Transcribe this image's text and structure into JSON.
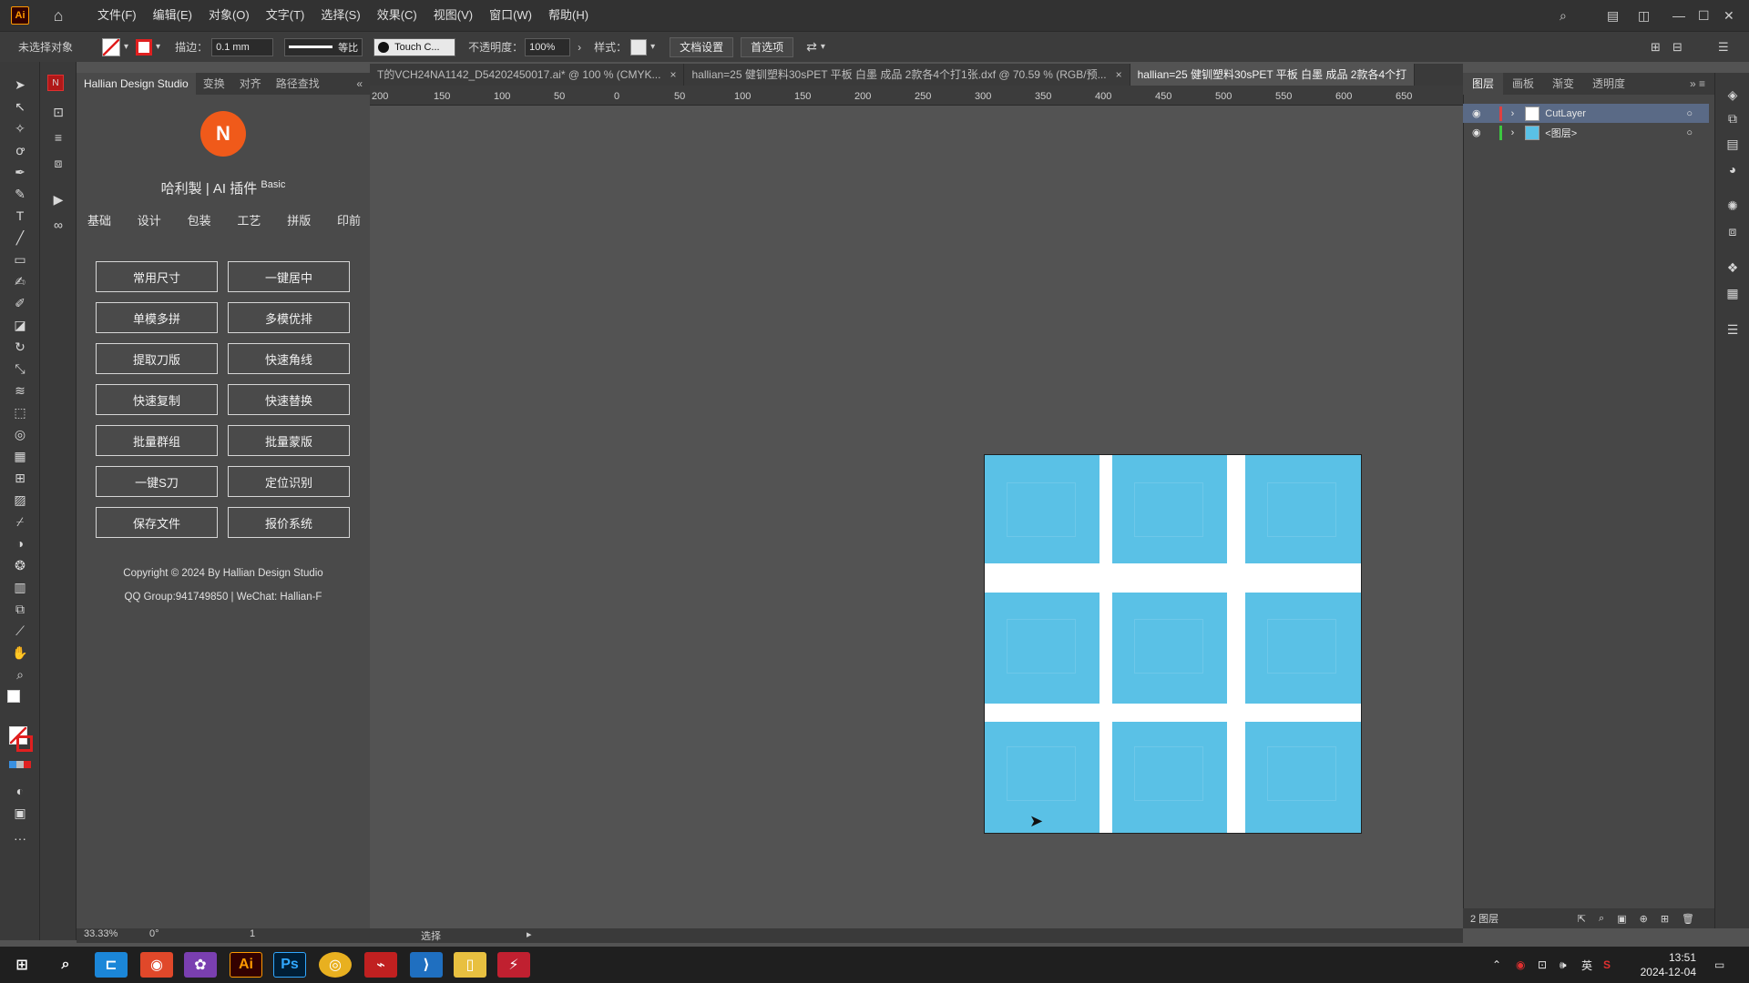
{
  "app": {
    "logo": "Ai",
    "menus": [
      "文件(F)",
      "编辑(E)",
      "对象(O)",
      "文字(T)",
      "选择(S)",
      "效果(C)",
      "视图(V)",
      "窗口(W)",
      "帮助(H)"
    ]
  },
  "control_bar": {
    "selection": "未选择对象",
    "stroke_label": "描边：",
    "stroke_value": "0.1 mm",
    "stroke_style": "等比",
    "brush": "Touch C...",
    "opacity_label": "不透明度：",
    "opacity_value": "100%",
    "style_label": "样式：",
    "doc_settings": "文档设置",
    "preferences": "首选项"
  },
  "plugin": {
    "tabs": [
      "Hallian Design Studio",
      "变换",
      "对齐",
      "路径查找"
    ],
    "logo_text": "N",
    "title": "哈利製 | AI 插件",
    "title_badge": "Basic",
    "nav": [
      "基础",
      "设计",
      "包装",
      "工艺",
      "拼版",
      "印前"
    ],
    "buttons": [
      [
        "常用尺寸",
        "一键居中"
      ],
      [
        "单模多拼",
        "多模优排"
      ],
      [
        "提取刀版",
        "快速角线"
      ],
      [
        "快速复制",
        "快速替换"
      ],
      [
        "批量群组",
        "批量蒙版"
      ],
      [
        "一键S刀",
        "定位识别"
      ],
      [
        "保存文件",
        "报价系统"
      ]
    ],
    "copyright": "Copyright © 2024 By Hallian Design Studio",
    "contact": "QQ Group:941749850 | WeChat: Hallian-F"
  },
  "doc_tabs": [
    {
      "title": "T的VCH24NA1142_D54202450017.ai* @ 100 % (CMYK...",
      "active": false
    },
    {
      "title": "hallian=25  健钏塑料30sPET 平板  白墨  成品 2款各4个打1张.dxf @ 70.59 % (RGB/预...",
      "active": false
    },
    {
      "title": "hallian=25  健钏塑料30sPET 平板  白墨  成品 2款各4个打",
      "active": true
    }
  ],
  "ruler_ticks": [
    "200",
    "150",
    "100",
    "50",
    "0",
    "50",
    "100",
    "150",
    "200",
    "250",
    "300",
    "350",
    "400",
    "450",
    "500",
    "550",
    "600",
    "650"
  ],
  "artboard": {
    "fill": "#5ac1e6",
    "gap": "#ffffff"
  },
  "layers_panel": {
    "tabs": [
      "图层",
      "画板",
      "渐变",
      "透明度"
    ],
    "layers": [
      {
        "name": "CutLayer",
        "color": "#e04040"
      },
      {
        "name": "<图层>",
        "color": "#3cc840"
      }
    ],
    "count": "2 图层"
  },
  "status": {
    "zoom": "33.33%",
    "rotation": "0°",
    "artboard_num": "1",
    "tool": "选择"
  },
  "taskbar": {
    "time": "13:51",
    "date": "2024-12-04",
    "ime": "英"
  }
}
